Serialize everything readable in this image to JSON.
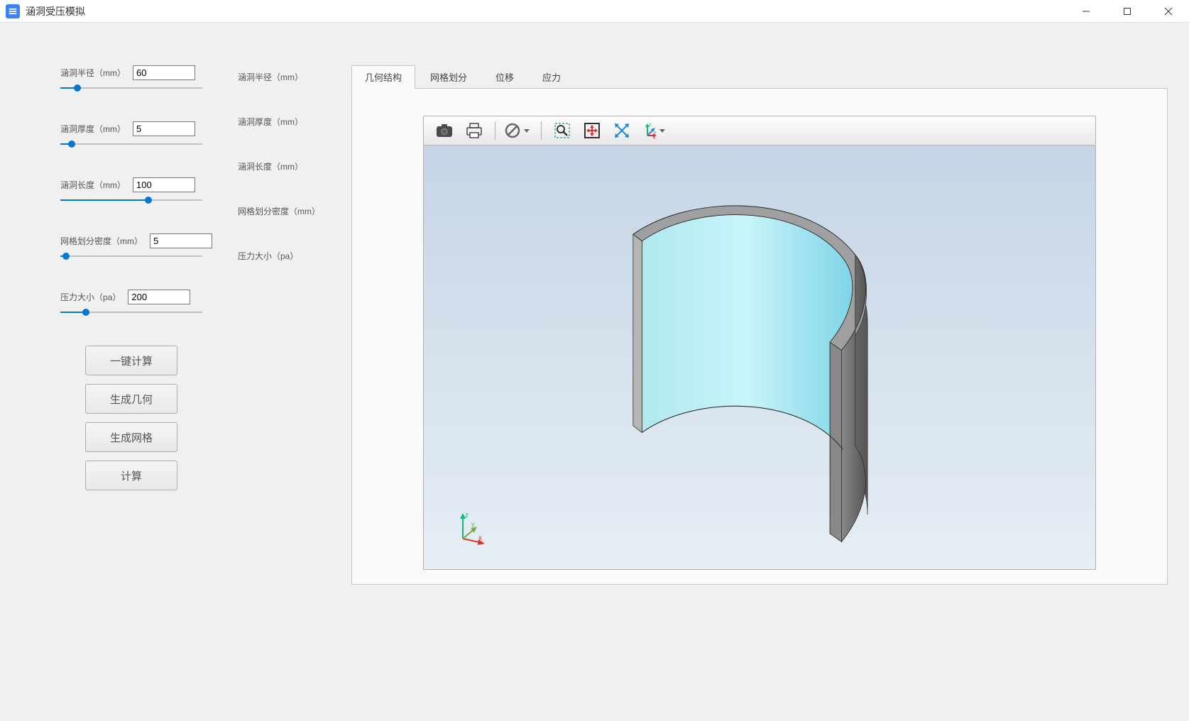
{
  "window": {
    "title": "涵洞受压模拟"
  },
  "params": {
    "radius": {
      "label": "涵洞半径（mm）",
      "value": "60",
      "slider_pct": 12
    },
    "thickness": {
      "label": "涵洞厚度（mm）",
      "value": "5",
      "slider_pct": 8
    },
    "length": {
      "label": "涵洞长度（mm）",
      "value": "100",
      "slider_pct": 62
    },
    "meshdensity": {
      "label": "网格划分密度（mm）",
      "value": "5",
      "slider_pct": 4
    },
    "pressure": {
      "label": "压力大小（pa）",
      "value": "200",
      "slider_pct": 18
    }
  },
  "summary": {
    "radius": "涵洞半径（mm）",
    "thickness": "涵洞厚度（mm）",
    "length": "涵洞长度（mm）",
    "meshdensity": "网格划分密度（mm）",
    "pressure": "压力大小（pa）"
  },
  "buttons": {
    "one_click": "一键计算",
    "gen_geom": "生成几何",
    "gen_mesh": "生成网格",
    "compute": "计算"
  },
  "tabs": {
    "geometry": "几何结构",
    "mesh": "网格划分",
    "displacement": "位移",
    "stress": "应力"
  },
  "active_tab": "geometry",
  "axis": {
    "x": "x",
    "y": "y",
    "z": "z"
  }
}
